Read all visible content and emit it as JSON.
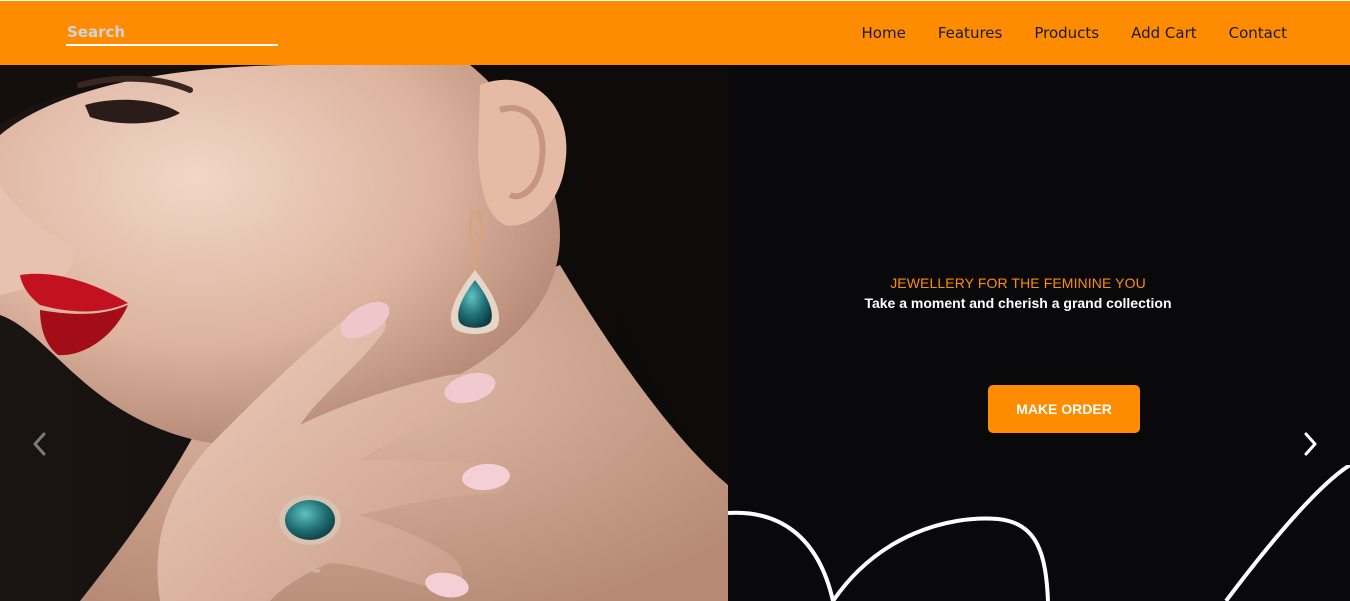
{
  "search": {
    "placeholder": "Search"
  },
  "nav": {
    "items": [
      {
        "label": "Home"
      },
      {
        "label": "Features"
      },
      {
        "label": "Products"
      },
      {
        "label": "Add Cart"
      },
      {
        "label": "Contact"
      }
    ]
  },
  "hero": {
    "tagline": "JEWELLERY FOR THE FEMININE YOU",
    "subtitle": "Take a moment and cherish a grand collection",
    "cta_label": "MAKE ORDER",
    "prev_icon": "chevron-left-icon",
    "next_icon": "chevron-right-icon"
  },
  "colors": {
    "accent": "#ff8c00",
    "hero_background": "#09090b",
    "text_white": "#ffffff"
  }
}
